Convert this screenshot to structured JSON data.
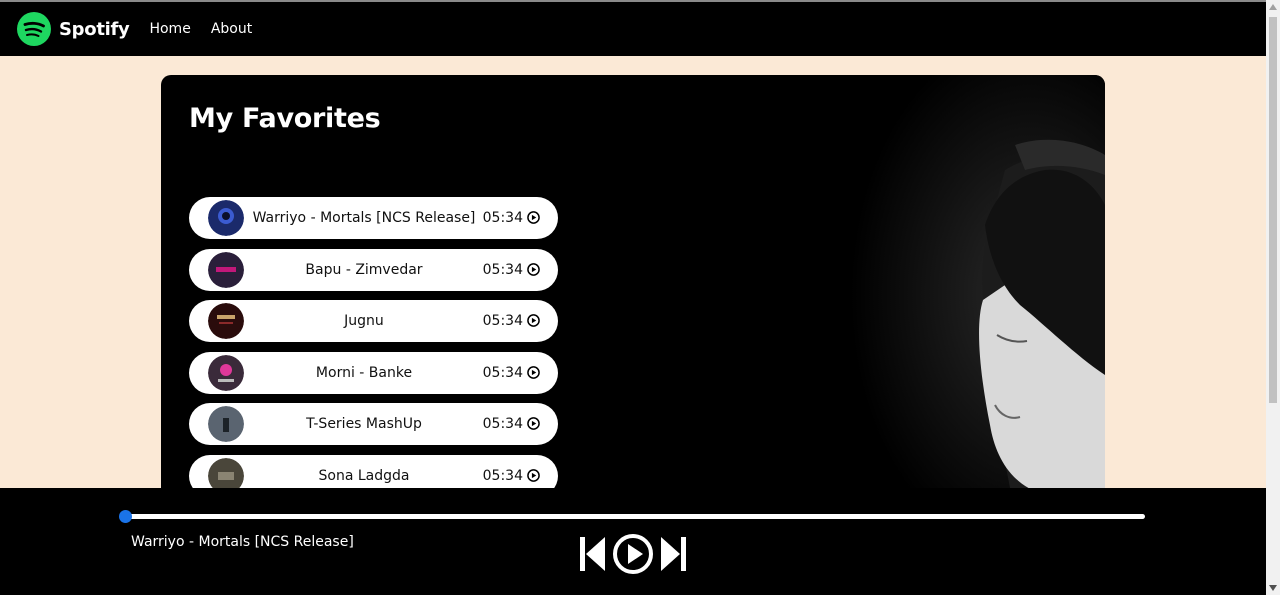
{
  "nav": {
    "brand": "Spotify",
    "links": [
      "Home",
      "About"
    ]
  },
  "favorites": {
    "title": "My Favorites",
    "songs": [
      {
        "name": "Warriyo - Mortals [NCS Release]",
        "duration": "05:34",
        "cover_color": "#1b2a6b"
      },
      {
        "name": "Bapu - Zimvedar",
        "duration": "05:34",
        "cover_color": "#2a1f3a"
      },
      {
        "name": "Jugnu",
        "duration": "05:34",
        "cover_color": "#2a0c0c"
      },
      {
        "name": "Morni - Banke",
        "duration": "05:34",
        "cover_color": "#3a2a3a"
      },
      {
        "name": "T-Series MashUp",
        "duration": "05:34",
        "cover_color": "#5a6470"
      },
      {
        "name": "Sona Ladgda",
        "duration": "05:34",
        "cover_color": "#4a463a"
      }
    ]
  },
  "player": {
    "now_playing": "Warriyo - Mortals [NCS Release]",
    "progress": 0.0
  },
  "colors": {
    "page_bg": "#fbe9d6",
    "brand_green": "#1ed760",
    "progress_accent": "#1a73e8"
  }
}
